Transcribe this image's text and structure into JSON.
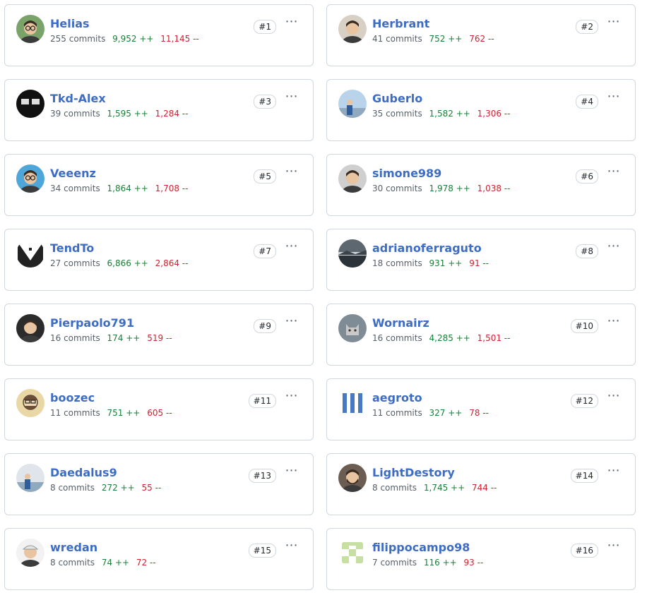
{
  "contributors": [
    {
      "rank": "#1",
      "name": "Helias",
      "commits": "255 commits",
      "additions": "9,952 ++",
      "deletions": "11,145 --",
      "avatar": "person-glasses-icon",
      "bg": "#7aa36a"
    },
    {
      "rank": "#2",
      "name": "Herbrant",
      "commits": "41 commits",
      "additions": "752 ++",
      "deletions": "762 --",
      "avatar": "person-icon",
      "bg": "#d8d0c4"
    },
    {
      "rank": "#3",
      "name": "Tkd-Alex",
      "commits": "39 commits",
      "additions": "1,595 ++",
      "deletions": "1,284 --",
      "avatar": "dark-logo-icon",
      "bg": "#111111"
    },
    {
      "rank": "#4",
      "name": "Guberlo",
      "commits": "35 commits",
      "additions": "1,582 ++",
      "deletions": "1,306 --",
      "avatar": "landscape-person-icon",
      "bg": "#b8d3ea"
    },
    {
      "rank": "#5",
      "name": "Veeenz",
      "commits": "34 commits",
      "additions": "1,864 ++",
      "deletions": "1,708 --",
      "avatar": "person-glasses-icon",
      "bg": "#4fa6d8"
    },
    {
      "rank": "#6",
      "name": "simone989",
      "commits": "30 commits",
      "additions": "1,978 ++",
      "deletions": "1,038 --",
      "avatar": "person-icon",
      "bg": "#cfcfcf"
    },
    {
      "rank": "#7",
      "name": "TendTo",
      "commits": "27 commits",
      "additions": "6,866 ++",
      "deletions": "2,864 --",
      "avatar": "penguin-icon",
      "bg": "#ffffff"
    },
    {
      "rank": "#8",
      "name": "adrianoferraguto",
      "commits": "18 commits",
      "additions": "931 ++",
      "deletions": "91 --",
      "avatar": "landscape-icon",
      "bg": "#5c6770"
    },
    {
      "rank": "#9",
      "name": "Pierpaolo791",
      "commits": "16 commits",
      "additions": "174 ++",
      "deletions": "519 --",
      "avatar": "person-icon",
      "bg": "#2b2b2b"
    },
    {
      "rank": "#10",
      "name": "Wornairz",
      "commits": "16 commits",
      "additions": "4,285 ++",
      "deletions": "1,501 --",
      "avatar": "cat-icon",
      "bg": "#7f8c96"
    },
    {
      "rank": "#11",
      "name": "boozec",
      "commits": "11 commits",
      "additions": "751 ++",
      "deletions": "605 --",
      "avatar": "cartoon-person-icon",
      "bg": "#e9d8a6"
    },
    {
      "rank": "#12",
      "name": "aegroto",
      "commits": "11 commits",
      "additions": "327 ++",
      "deletions": "78 --",
      "avatar": "identicon-icon",
      "bg": "#eef2f8"
    },
    {
      "rank": "#13",
      "name": "Daedalus9",
      "commits": "8 commits",
      "additions": "272 ++",
      "deletions": "55 --",
      "avatar": "landscape-person-icon",
      "bg": "#dfe5ea"
    },
    {
      "rank": "#14",
      "name": "LightDestory",
      "commits": "8 commits",
      "additions": "1,745 ++",
      "deletions": "744 --",
      "avatar": "person-beard-icon",
      "bg": "#6b5d52"
    },
    {
      "rank": "#15",
      "name": "wredan",
      "commits": "8 commits",
      "additions": "74 ++",
      "deletions": "72 --",
      "avatar": "person-cap-icon",
      "bg": "#f2f2f2"
    },
    {
      "rank": "#16",
      "name": "filippocampo98",
      "commits": "7 commits",
      "additions": "116 ++",
      "deletions": "93 --",
      "avatar": "identicon-icon",
      "bg": "#f1f5e6"
    }
  ],
  "more_icon": "kebab-menu-icon",
  "colors": {
    "link": "#3d6cc7",
    "additions": "#1a7f37",
    "deletions": "#cf222e",
    "border": "#d0d7de"
  }
}
